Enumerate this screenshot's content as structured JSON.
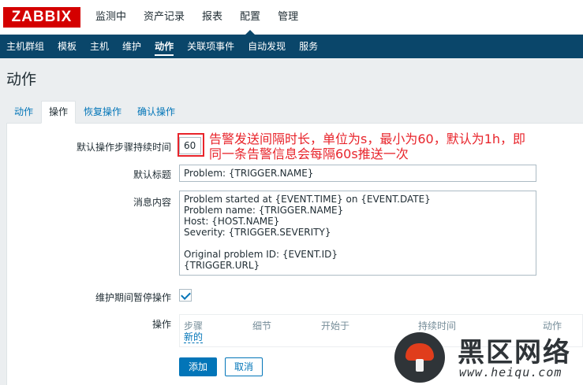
{
  "header": {
    "logo": "ZABBIX",
    "menu": [
      "监测中",
      "资产记录",
      "报表",
      "配置",
      "管理"
    ],
    "active_menu": "配置"
  },
  "subnav": {
    "items": [
      "主机群组",
      "模板",
      "主机",
      "维护",
      "动作",
      "关联项事件",
      "自动发现",
      "服务"
    ],
    "active": "动作"
  },
  "page": {
    "title": "动作",
    "tabs": [
      "动作",
      "操作",
      "恢复操作",
      "确认操作"
    ],
    "active_tab": "操作"
  },
  "form": {
    "step_duration_label": "默认操作步骤持续时间",
    "step_duration_value": "60",
    "subject_label": "默认标题",
    "subject_value": "Problem: {TRIGGER.NAME}",
    "message_label": "消息内容",
    "message_value": "Problem started at {EVENT.TIME} on {EVENT.DATE}\nProblem name: {TRIGGER.NAME}\nHost: {HOST.NAME}\nSeverity: {TRIGGER.SEVERITY}\n\nOriginal problem ID: {EVENT.ID}\n{TRIGGER.URL}",
    "pause_label": "维护期间暂停操作",
    "pause_checked": true,
    "operations_label": "操作",
    "operations_columns": [
      "步骤",
      "细节",
      "开始于",
      "持续时间",
      "动作"
    ],
    "new_link": "新的",
    "add_button": "添加",
    "cancel_button": "取消"
  },
  "annotation": {
    "line1": "告警发送间隔时长，单位为s，最小为60，默认为1h，即",
    "line2": "同一条告警信息会每隔60s推送一次",
    "color": "#e8242b"
  },
  "watermark": {
    "text": "黑区网络",
    "url": "www.heiqu.com"
  },
  "colors": {
    "brand": "#d40000",
    "subnav_bg": "#0a466a",
    "link": "#0275b8"
  }
}
